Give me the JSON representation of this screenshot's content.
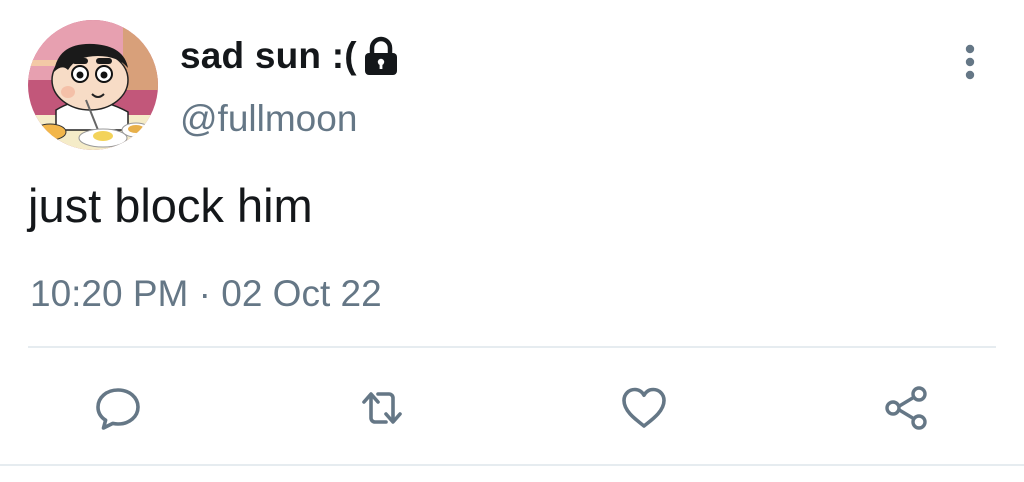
{
  "user": {
    "display_name": "sad sun :(",
    "handle": "@fullmoon",
    "avatar_icon": "cartoon-boy-eating-avatar",
    "protected_icon": "lock-icon"
  },
  "tweet": {
    "text": "just block him",
    "timestamp": "10:20 PM · 02 Oct 22"
  },
  "actions": [
    {
      "name": "reply",
      "icon": "speech-bubble-icon"
    },
    {
      "name": "retweet",
      "icon": "retweet-arrows-icon"
    },
    {
      "name": "like",
      "icon": "heart-icon"
    },
    {
      "name": "share",
      "icon": "share-nodes-icon"
    }
  ],
  "menu": {
    "icon": "vertical-dots-icon"
  },
  "colors": {
    "text_primary": "#14171a",
    "text_secondary": "#657786",
    "icon_gray": "#657786",
    "divider": "#e6ecf0"
  }
}
